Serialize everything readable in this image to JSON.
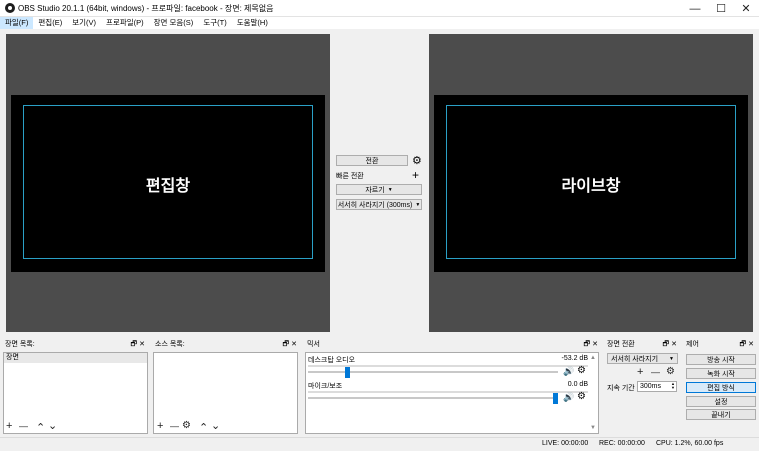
{
  "window": {
    "title": "OBS Studio 20.1.1 (64bit, windows) - 프로파일: facebook - 장면: 제목없음",
    "minimize_label": "—",
    "maximize_label": "☐",
    "close_label": "✕"
  },
  "menu": [
    "파일(F)",
    "편집(E)",
    "보기(V)",
    "프로파일(P)",
    "장면 모음(S)",
    "도구(T)",
    "도움말(H)"
  ],
  "preview": {
    "edit_label": "편집창",
    "live_label": "라이브창"
  },
  "transition_controls": {
    "transition_button": "전환",
    "quick_label": "빠른 전환",
    "cut_select": "자르기",
    "fade_select": "서서히 사라지기 (300ms)"
  },
  "scenes_dock": {
    "title": "장면 목록:",
    "items": [
      "장면"
    ]
  },
  "sources_dock": {
    "title": "소스 목록:"
  },
  "mixer": {
    "title": "믹서",
    "channels": [
      {
        "name": "데스크탑 오디오",
        "db": "-53.2 dB",
        "level": 0.15
      },
      {
        "name": "마이크/보조",
        "db": "0.0 dB",
        "level": 1.0
      }
    ]
  },
  "scene_transitions": {
    "title": "장면 전환",
    "selected": "서서히 사라지기",
    "duration_label": "지속 기간",
    "duration_value": "300ms"
  },
  "controls": {
    "title": "제어",
    "buttons": [
      "방송 시작",
      "녹화 시작",
      "편집 방식",
      "설정",
      "끝내기"
    ]
  },
  "status": {
    "live": "LIVE: 00:00:00",
    "rec": "REC: 00:00:00",
    "cpu": "CPU: 1.2%, 60.00 fps"
  },
  "icons": {
    "gear": "⚙",
    "plus": "+",
    "minus": "—",
    "up": "⌃",
    "down": "⌄",
    "speaker": "🔊",
    "float": "🗗",
    "close": "✕"
  }
}
